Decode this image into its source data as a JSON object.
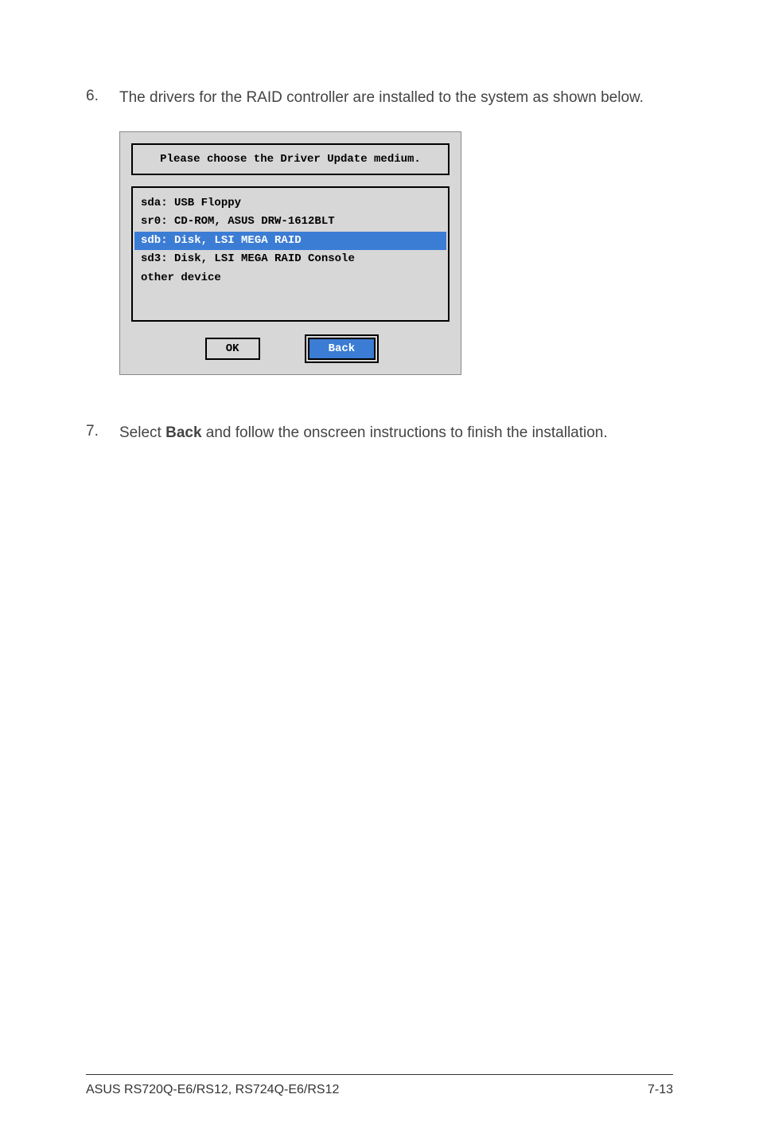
{
  "steps": {
    "s6": {
      "num": "6.",
      "text_before": "The drivers for the RAID controller are installed to the system as shown below."
    },
    "s7": {
      "num": "7.",
      "prefix": "Select ",
      "bold": "Back",
      "suffix": " and follow the onscreen instructions to finish the installation."
    }
  },
  "dialog": {
    "title": "Please choose the Driver Update medium.",
    "items": {
      "i0": "sda: USB Floppy",
      "i1": "sr0: CD-ROM, ASUS DRW-1612BLT",
      "i2": "sdb: Disk, LSI MEGA RAID",
      "i3": "sd3: Disk, LSI MEGA RAID Console",
      "i4": "other device"
    },
    "buttons": {
      "ok": "OK",
      "back": "Back"
    }
  },
  "footer": {
    "left": "ASUS RS720Q-E6/RS12, RS724Q-E6/RS12",
    "right": "7-13"
  }
}
